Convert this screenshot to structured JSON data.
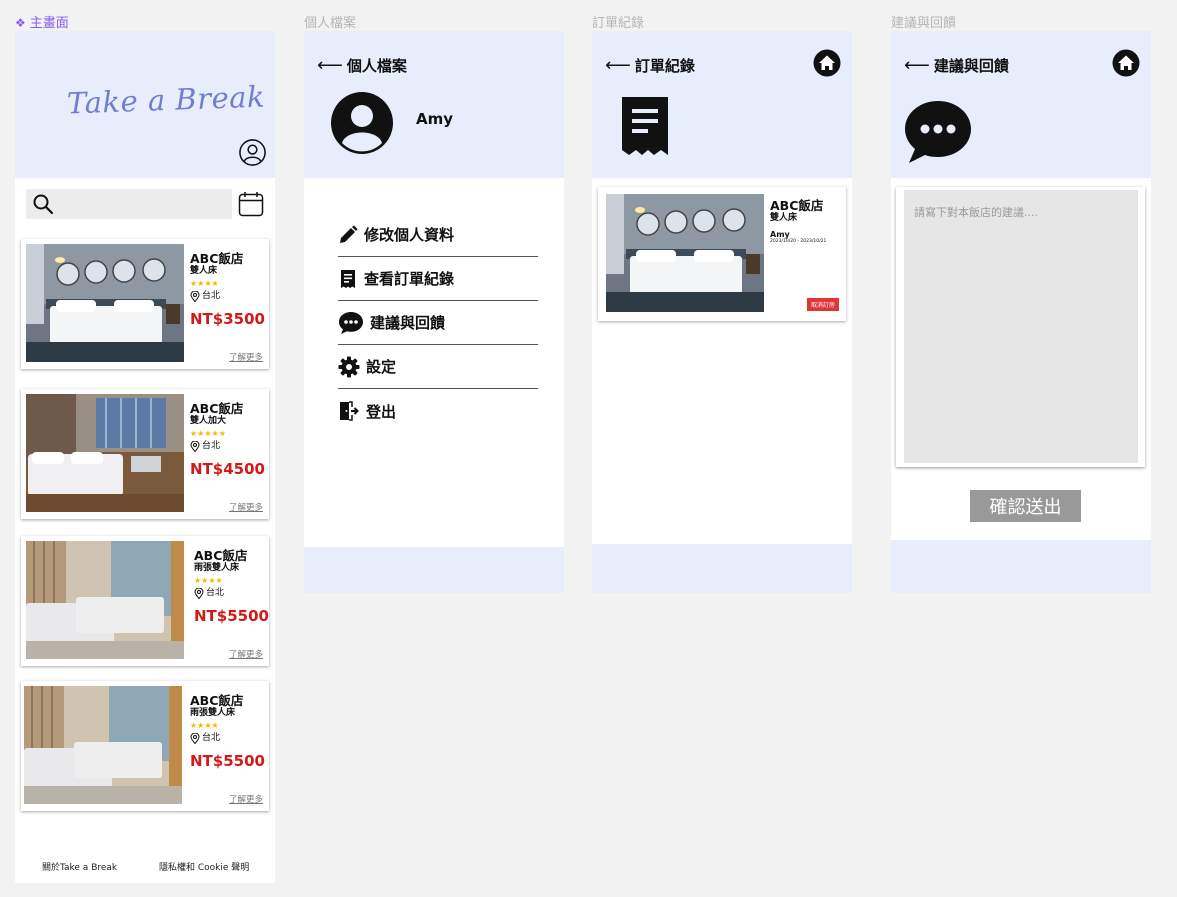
{
  "frames": {
    "home_label": "主畫面",
    "profile_label": "個人檔案",
    "orders_label": "訂單紀錄",
    "feedback_label": "建議與回饋"
  },
  "home": {
    "logo": "Take a Break",
    "search": {
      "placeholder": ""
    },
    "hotels": [
      {
        "name": "ABC飯店",
        "room": "雙人床",
        "stars": "★★★★",
        "location": "台北",
        "price": "NT$3500",
        "more": "了解更多"
      },
      {
        "name": "ABC飯店",
        "room": "雙人加大",
        "stars": "★★★★★",
        "location": "台北",
        "price": "NT$4500",
        "more": "了解更多"
      },
      {
        "name": "ABC飯店",
        "room": "雨張雙人床",
        "stars": "★★★★",
        "location": "台北",
        "price": "NT$5500",
        "more": "了解更多"
      },
      {
        "name": "ABC飯店",
        "room": "雨張雙人床",
        "stars": "★★★★",
        "location": "台北",
        "price": "NT$5500",
        "more": "了解更多"
      }
    ],
    "footer": {
      "about": "關於Take a Break",
      "privacy": "隱私權和 Cookie 聲明"
    }
  },
  "profile": {
    "title": "個人檔案",
    "name": "Amy",
    "menu": [
      "修改個人資料",
      "查看訂單紀錄",
      "建議與回饋",
      "設定",
      "登出"
    ]
  },
  "orders": {
    "title": "訂單紀錄",
    "card": {
      "name": "ABC飯店",
      "room": "雙人床",
      "guest": "Amy",
      "dates": "2023/10/20 - 2023/10/21",
      "cancel": "取消訂房"
    }
  },
  "feedback": {
    "title": "建議與回饋",
    "placeholder": "請寫下對本飯店的建議....",
    "submit": "確認送出"
  },
  "colors": {
    "lavender": "#e8edfb",
    "price_red": "#d21a1a",
    "star_gold": "#f5b800",
    "logo_blue": "#6e7fd1",
    "cancel_red": "#e03535",
    "submit_gray": "#999999"
  }
}
